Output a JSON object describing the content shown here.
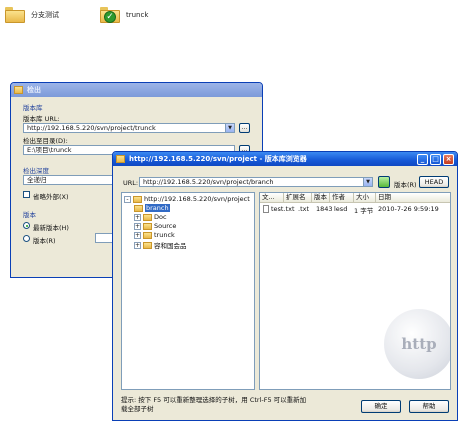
{
  "desktop": {
    "items": [
      {
        "label": "分支测试"
      },
      {
        "label": "trunck"
      }
    ]
  },
  "checkout_dialog": {
    "title": "检出",
    "repo_group": "版本库",
    "url_label": "版本库 URL:",
    "url_value": "http://192.168.5.220/svn/project/trunck",
    "dir_label": "检出至目录(D):",
    "dir_value": "E:\\项目\\trunck",
    "depth_group": "检出深度",
    "depth_value": "全递归",
    "omit_externals": "省略外部(X)",
    "revision_group": "版本",
    "head_revision": "最新版本(H)",
    "revision": "版本(R)",
    "browse_btn": "..."
  },
  "repo_browser": {
    "title": "http://192.168.5.220/svn/project - 版本库浏览器",
    "url_label": "URL:",
    "url_value": "http://192.168.5.220/svn/project/branch",
    "head_button": "HEAD",
    "tree": [
      {
        "label": "http://192.168.5.220/svn/project",
        "expander": "-"
      },
      {
        "label": "branch",
        "selected": true,
        "expander": ""
      },
      {
        "label": "Doc",
        "expander": "+"
      },
      {
        "label": "Source",
        "expander": "+"
      },
      {
        "label": "trunck",
        "expander": "+"
      },
      {
        "label": "容和国会品",
        "expander": "+"
      }
    ],
    "columns": [
      "文...",
      "扩展名",
      "版本",
      "作者",
      "大小",
      "日期"
    ],
    "rows": [
      {
        "file": "test.txt",
        "ext": ".txt",
        "rev": "1843",
        "author": "lesd",
        "size": "1 字节",
        "date": "2010-7-26 9:59:19"
      }
    ],
    "hint": "提示: 按下 F5 可以重新整理选择的子树，用 Ctrl-F5 可以重新加载全部子树",
    "ok_button": "确定",
    "help_button": "帮助",
    "watermark": "http"
  }
}
